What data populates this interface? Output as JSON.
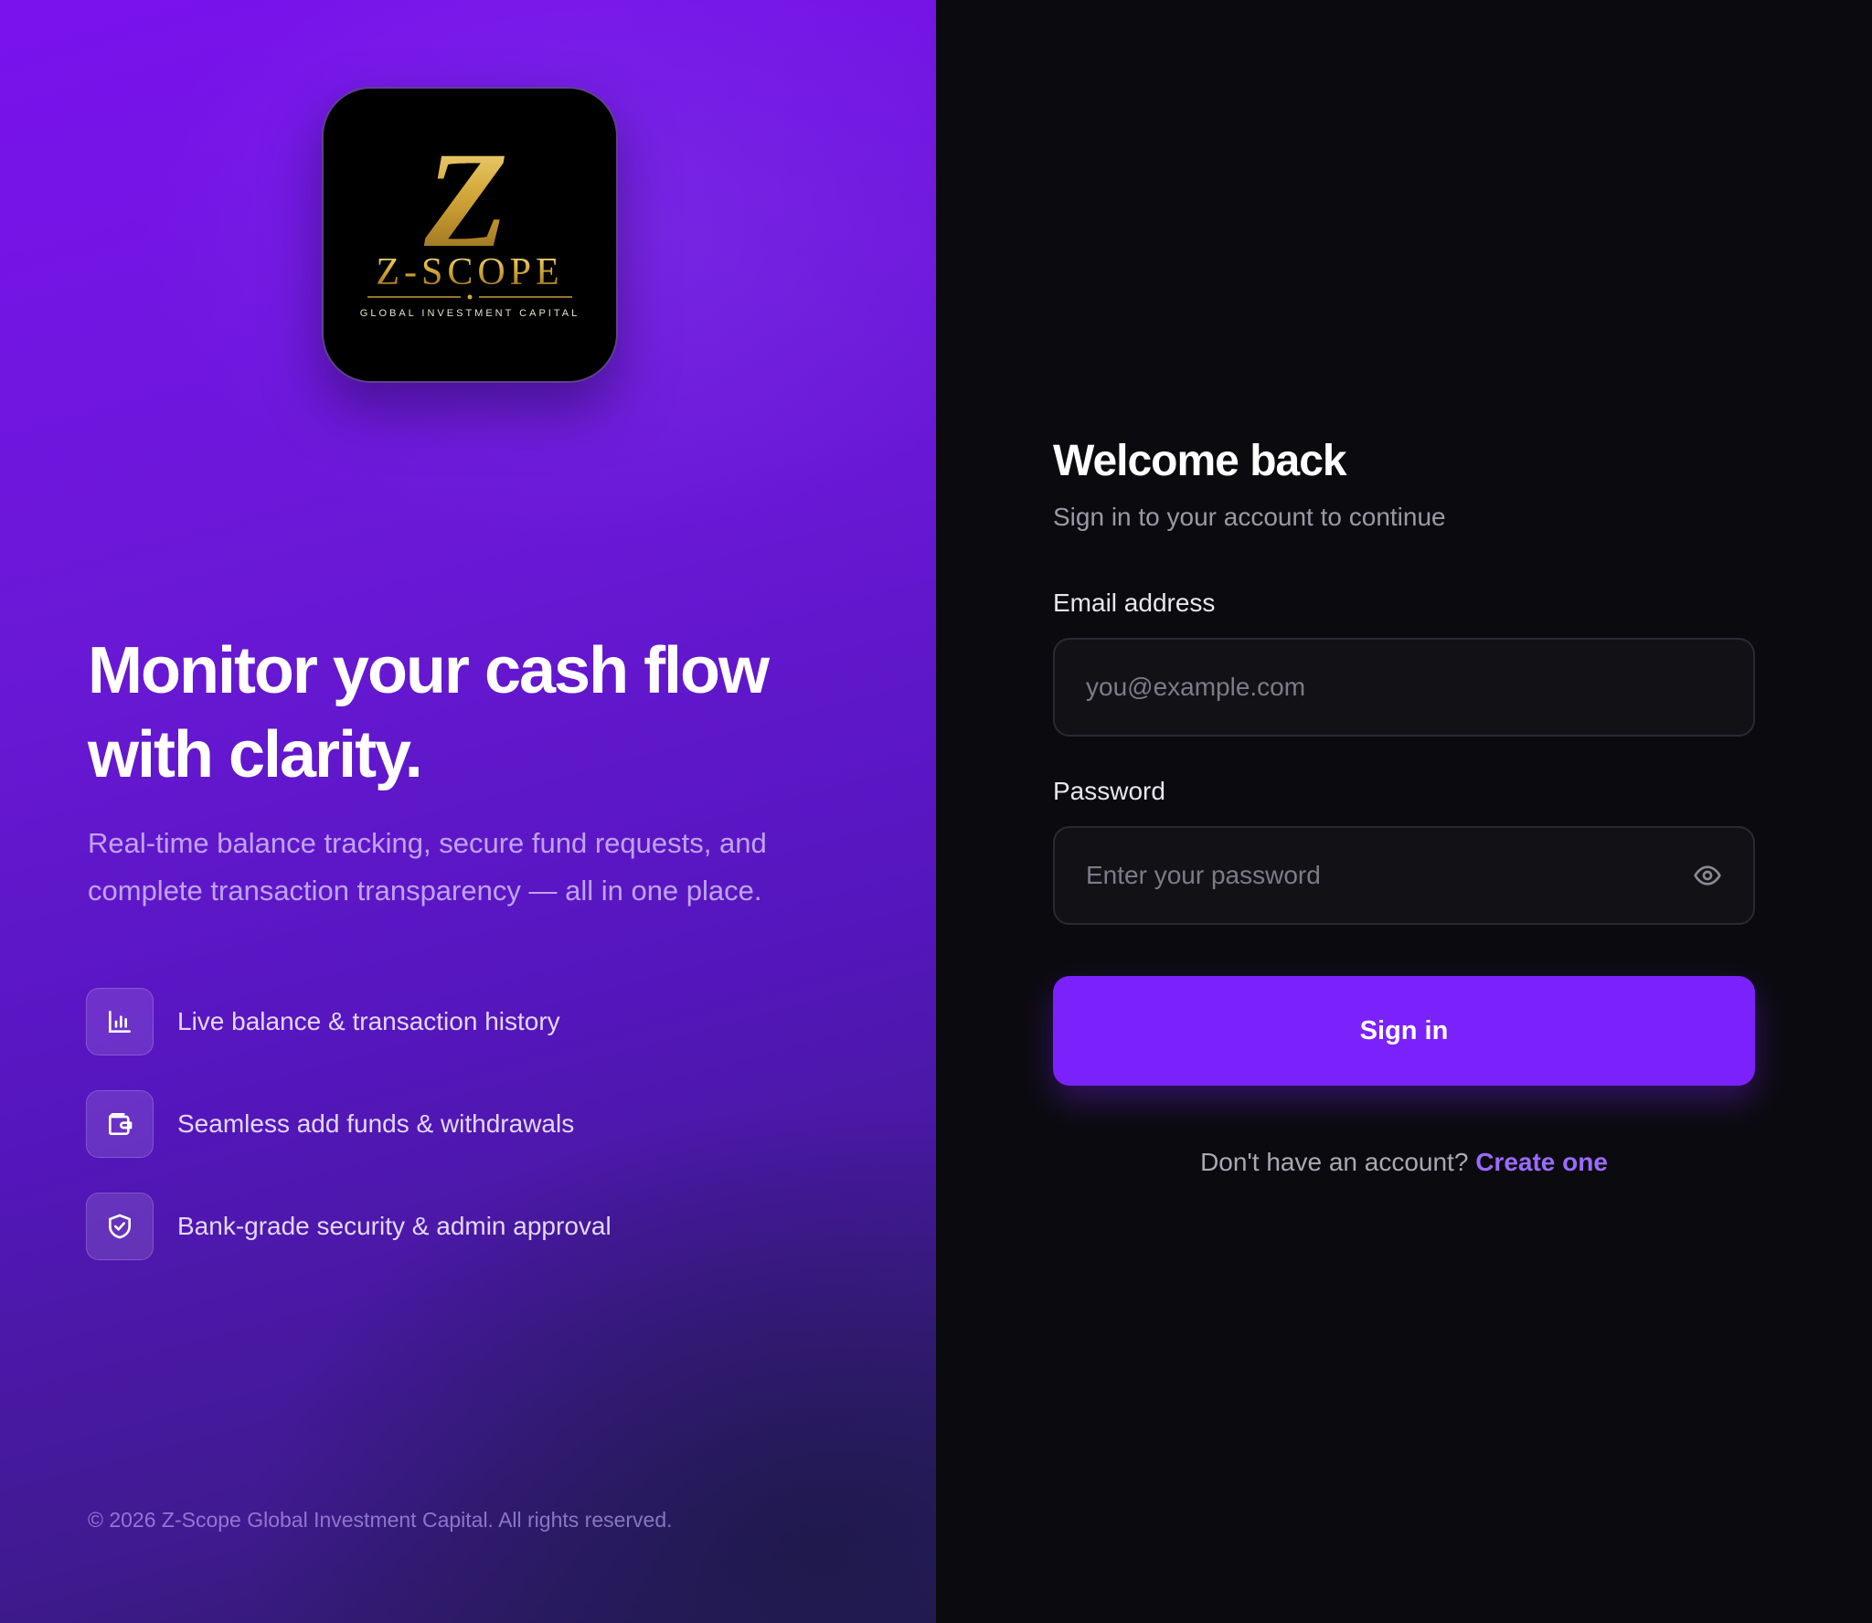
{
  "brand": {
    "logo_mark": "Z",
    "logo_name": "Z-SCOPE",
    "logo_tagline": "GLOBAL INVESTMENT CAPITAL"
  },
  "hero": {
    "headline_line1": "Monitor your cash flow",
    "headline_line2": "with clarity.",
    "subtext": "Real-time balance tracking, secure fund requests, and complete transaction transparency — all in one place."
  },
  "features": [
    {
      "icon": "bar-chart-icon",
      "label": "Live balance & transaction history"
    },
    {
      "icon": "wallet-icon",
      "label": "Seamless add funds & withdrawals"
    },
    {
      "icon": "shield-check-icon",
      "label": "Bank-grade security & admin approval"
    }
  ],
  "footer": {
    "copyright": "© 2026 Z-Scope Global Investment Capital. All rights reserved."
  },
  "login": {
    "title": "Welcome back",
    "subtitle": "Sign in to your account to continue",
    "email_label": "Email address",
    "email_placeholder": "you@example.com",
    "email_value": "",
    "password_label": "Password",
    "password_placeholder": "Enter your password",
    "password_value": "",
    "password_toggle_icon": "eye-icon",
    "submit_label": "Sign in",
    "signup_prompt": "Don't have an account?",
    "signup_link": "Create one"
  },
  "colors": {
    "accent": "#7b22fc",
    "link": "#9b6bff",
    "panel_dark": "#0b0b0f",
    "gold": "#d4a93a"
  }
}
